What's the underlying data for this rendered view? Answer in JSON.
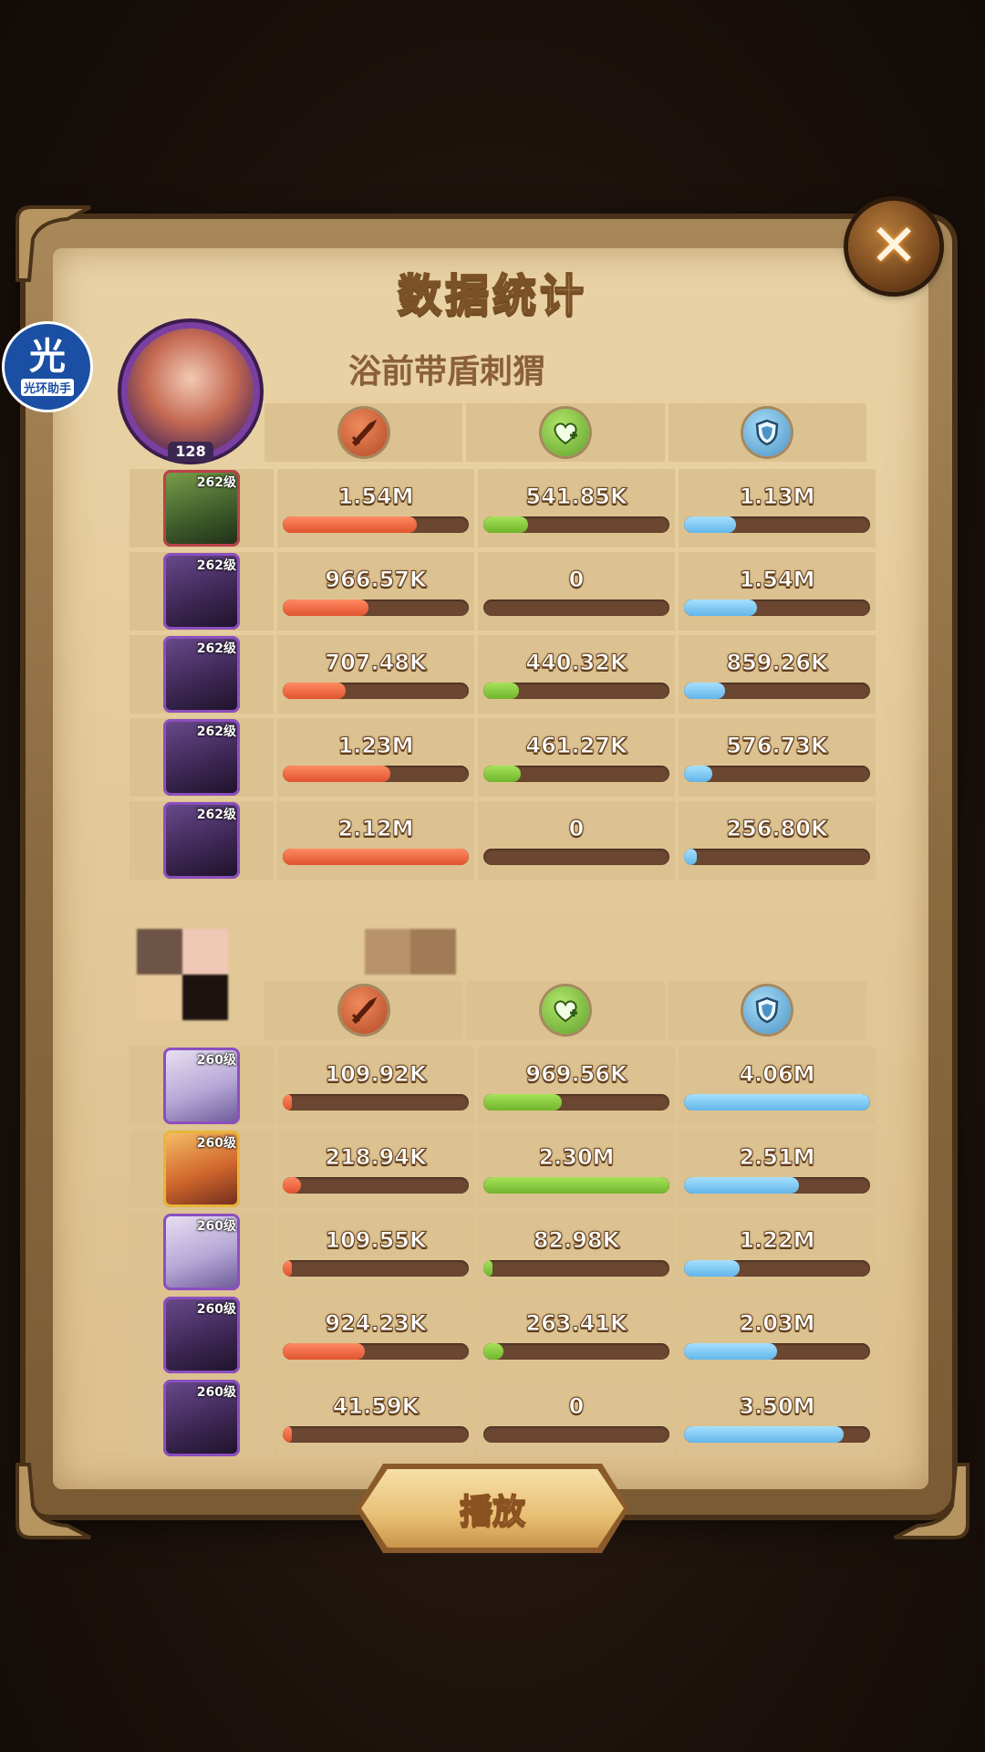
{
  "title": "数据统计",
  "close_icon": "close-icon",
  "watermark": {
    "big": "光",
    "small": "光环助手"
  },
  "team1": {
    "player_name": "浴前带盾刺猬",
    "player_level": "128",
    "heroes": [
      {
        "level": "262级",
        "damage": "1.54M",
        "heal": "541.85K",
        "shield": "1.13M",
        "damage_frac": 0.72,
        "heal_frac": 0.24,
        "shield_frac": 0.28,
        "style": "green"
      },
      {
        "level": "262级",
        "damage": "966.57K",
        "heal": "0",
        "shield": "1.54M",
        "damage_frac": 0.46,
        "heal_frac": 0,
        "shield_frac": 0.39,
        "style": "purple"
      },
      {
        "level": "262级",
        "damage": "707.48K",
        "heal": "440.32K",
        "shield": "859.26K",
        "damage_frac": 0.34,
        "heal_frac": 0.19,
        "shield_frac": 0.22,
        "style": "purple"
      },
      {
        "level": "262级",
        "damage": "1.23M",
        "heal": "461.27K",
        "shield": "576.73K",
        "damage_frac": 0.58,
        "heal_frac": 0.2,
        "shield_frac": 0.15,
        "style": "purple"
      },
      {
        "level": "262级",
        "damage": "2.12M",
        "heal": "0",
        "shield": "256.80K",
        "damage_frac": 1.0,
        "heal_frac": 0,
        "shield_frac": 0.07,
        "style": "purple"
      }
    ]
  },
  "team2": {
    "heroes": [
      {
        "level": "260级",
        "damage": "109.92K",
        "heal": "969.56K",
        "shield": "4.06M",
        "damage_frac": 0.05,
        "heal_frac": 0.42,
        "shield_frac": 1.0,
        "style": "light"
      },
      {
        "level": "260级",
        "damage": "218.94K",
        "heal": "2.30M",
        "shield": "2.51M",
        "damage_frac": 0.1,
        "heal_frac": 1.0,
        "shield_frac": 0.62,
        "style": "gold"
      },
      {
        "level": "260级",
        "damage": "109.55K",
        "heal": "82.98K",
        "shield": "1.22M",
        "damage_frac": 0.05,
        "heal_frac": 0.04,
        "shield_frac": 0.3,
        "style": "light"
      },
      {
        "level": "260级",
        "damage": "924.23K",
        "heal": "263.41K",
        "shield": "2.03M",
        "damage_frac": 0.44,
        "heal_frac": 0.11,
        "shield_frac": 0.5,
        "style": "purple"
      },
      {
        "level": "260级",
        "damage": "41.59K",
        "heal": "0",
        "shield": "3.50M",
        "damage_frac": 0.02,
        "heal_frac": 0,
        "shield_frac": 0.86,
        "style": "purple"
      }
    ]
  },
  "column_icons": [
    "damage-icon",
    "heal-icon",
    "shield-icon"
  ],
  "play_label": "播放"
}
